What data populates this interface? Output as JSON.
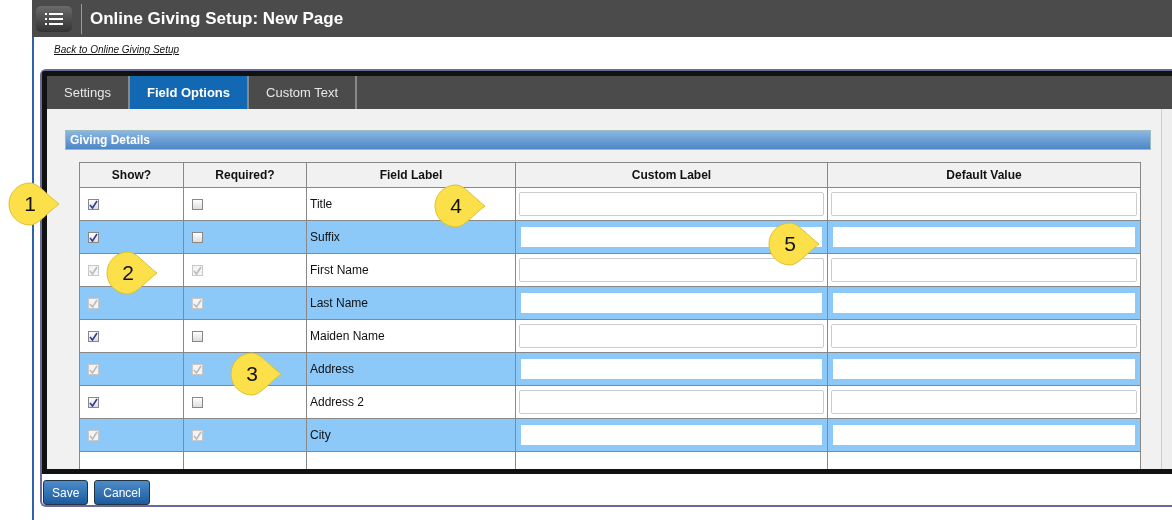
{
  "header": {
    "title": "Online Giving Setup: New Page"
  },
  "back_link": "Back to Online Giving Setup",
  "tabs": [
    {
      "label": "Settings",
      "selected": false
    },
    {
      "label": "Field Options",
      "selected": true
    },
    {
      "label": "Custom Text",
      "selected": false
    }
  ],
  "section": {
    "title": "Giving Details"
  },
  "table": {
    "columns": [
      "Show?",
      "Required?",
      "Field Label",
      "Custom Label",
      "Default Value"
    ],
    "rows": [
      {
        "show": {
          "checked": true,
          "disabled": false
        },
        "required": {
          "checked": false,
          "disabled": false
        },
        "label": "Title"
      },
      {
        "show": {
          "checked": true,
          "disabled": false
        },
        "required": {
          "checked": false,
          "disabled": false
        },
        "label": "Suffix"
      },
      {
        "show": {
          "checked": true,
          "disabled": true
        },
        "required": {
          "checked": true,
          "disabled": true
        },
        "label": "First Name"
      },
      {
        "show": {
          "checked": true,
          "disabled": true
        },
        "required": {
          "checked": true,
          "disabled": true
        },
        "label": "Last Name"
      },
      {
        "show": {
          "checked": true,
          "disabled": false
        },
        "required": {
          "checked": false,
          "disabled": false
        },
        "label": "Maiden Name"
      },
      {
        "show": {
          "checked": true,
          "disabled": true
        },
        "required": {
          "checked": true,
          "disabled": true
        },
        "label": "Address"
      },
      {
        "show": {
          "checked": true,
          "disabled": false
        },
        "required": {
          "checked": false,
          "disabled": false
        },
        "label": "Address 2"
      },
      {
        "show": {
          "checked": true,
          "disabled": true
        },
        "required": {
          "checked": true,
          "disabled": true
        },
        "label": "City"
      }
    ]
  },
  "buttons": [
    "Save",
    "Cancel"
  ],
  "callouts": [
    {
      "number": "1"
    },
    {
      "number": "2"
    },
    {
      "number": "3"
    },
    {
      "number": "4"
    },
    {
      "number": "5"
    }
  ]
}
